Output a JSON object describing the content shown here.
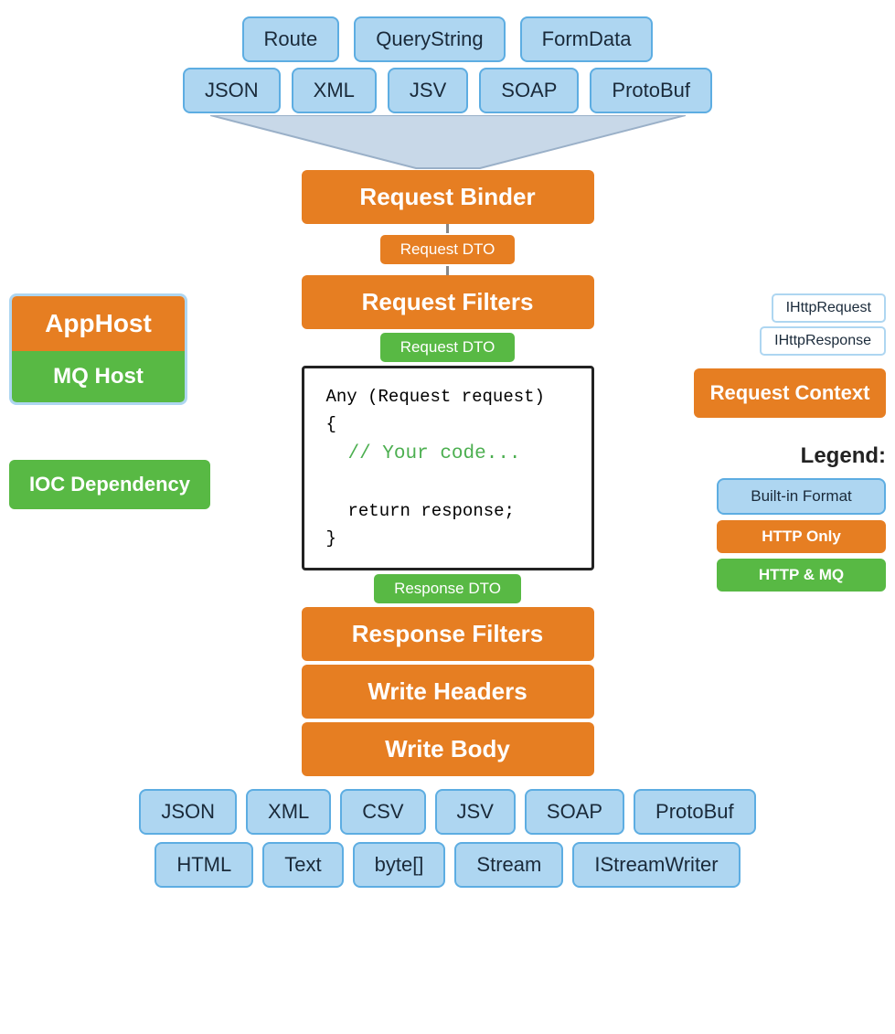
{
  "top_row1": {
    "items": [
      "Route",
      "QueryString",
      "FormData"
    ]
  },
  "top_row2": {
    "items": [
      "JSON",
      "XML",
      "JSV",
      "SOAP",
      "ProtoBuf"
    ]
  },
  "request_binder": "Request Binder",
  "request_dto_1": "Request DTO",
  "request_filters": "Request Filters",
  "request_dto_2": "Request DTO",
  "code": {
    "line1": "Any (Request request)",
    "line2": "{",
    "line3": "// Your code...",
    "line4": "return response;",
    "line5": "}"
  },
  "response_dto": "Response DTO",
  "response_filters": "Response Filters",
  "write_headers": "Write Headers",
  "write_body": "Write Body",
  "left": {
    "apphost": "AppHost",
    "mq_host": "MQ Host",
    "ioc_dependency": "IOC Dependency"
  },
  "right": {
    "ihttp_request": "IHttpRequest",
    "ihttp_response": "IHttpResponse",
    "request_context": "Request Context"
  },
  "legend": {
    "title": "Legend:",
    "built_in": "Built-in Format",
    "http_only": "HTTP Only",
    "http_mq": "HTTP & MQ"
  },
  "bottom_row1": {
    "items": [
      "JSON",
      "XML",
      "CSV",
      "JSV",
      "SOAP",
      "ProtoBuf"
    ]
  },
  "bottom_row2": {
    "items": [
      "HTML",
      "Text",
      "byte[]",
      "Stream",
      "IStreamWriter"
    ]
  }
}
